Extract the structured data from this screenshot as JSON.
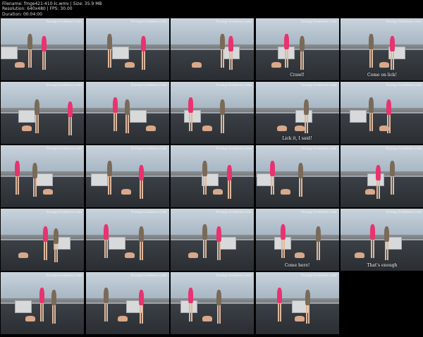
{
  "header": {
    "filename": "Filename: fmge421-410-lc.wmv | Size: 35.9 MB",
    "resolution": "Resolution: 640x480 | FPS: 30.00",
    "duration": "Duration: 00:04:00"
  },
  "watermark": "Young-Goddess.com",
  "thumbnails": [
    {
      "caption": ""
    },
    {
      "caption": ""
    },
    {
      "caption": ""
    },
    {
      "caption": "Crawl!"
    },
    {
      "caption": "Come on lick!"
    },
    {
      "caption": ""
    },
    {
      "caption": ""
    },
    {
      "caption": ""
    },
    {
      "caption": "Lick it, I said!"
    },
    {
      "caption": ""
    },
    {
      "caption": ""
    },
    {
      "caption": ""
    },
    {
      "caption": ""
    },
    {
      "caption": ""
    },
    {
      "caption": ""
    },
    {
      "caption": ""
    },
    {
      "caption": ""
    },
    {
      "caption": ""
    },
    {
      "caption": "Come here!"
    },
    {
      "caption": "That's enough"
    },
    {
      "caption": ""
    },
    {
      "caption": ""
    },
    {
      "caption": ""
    },
    {
      "caption": ""
    }
  ]
}
